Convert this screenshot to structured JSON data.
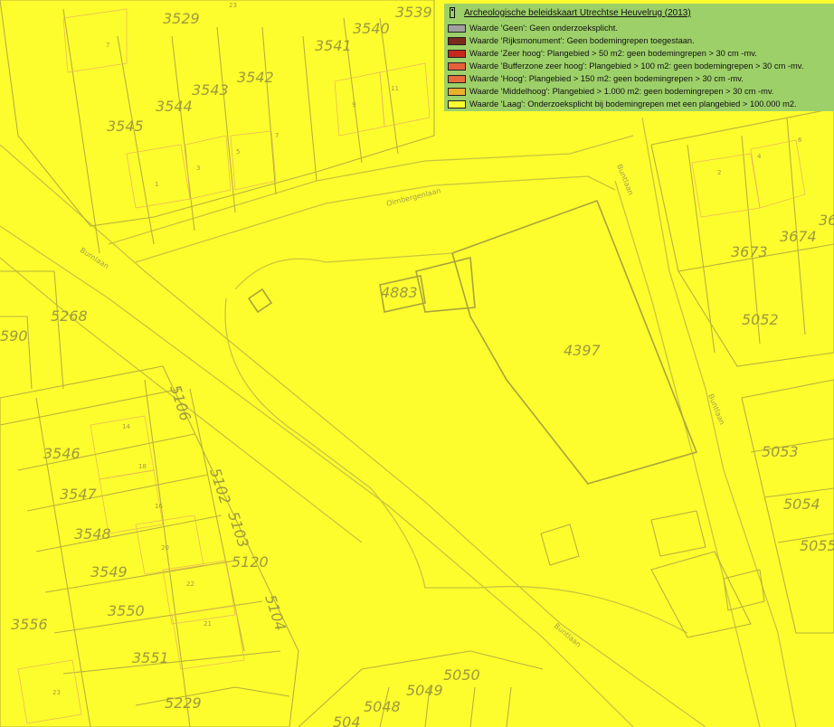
{
  "legend": {
    "title": "Archeologische beleidskaart Utrechtse Heuvelrug (2013)",
    "items": [
      {
        "label": "Waarde 'Geen': Geen onderzoeksplicht.",
        "color": "#a0a0a0"
      },
      {
        "label": "Waarde 'Rijksmonument': Geen bodemingrepen toegestaan.",
        "color": "#7b2a1c"
      },
      {
        "label": "Waarde 'Zeer hoog': Plangebied > 50 m2: geen bodemingrepen > 30 cm -mv.",
        "color": "#c8281c"
      },
      {
        "label": "Waarde 'Bufferzone zeer hoog': Plangebied > 100 m2: geen bodemingrepen > 30 cm -mv.",
        "color": "#e5603a"
      },
      {
        "label": "Waarde 'Hoog': Plangebied > 150 m2: geen bodemingrepen > 30 cm -mv.",
        "color": "#e86b3c"
      },
      {
        "label": "Waarde 'Middelhoog': Plangebied > 1.000 m2: geen bodemingrepen > 30 cm -mv.",
        "color": "#eab02a"
      },
      {
        "label": "Waarde 'Laag': Onderzoeksplicht bij bodemingrepen met een plangebied > 100.000 m2.",
        "color": "#fdfd2e"
      }
    ]
  },
  "parcels": [
    "3529",
    "3539",
    "3540",
    "3541",
    "3542",
    "3543",
    "3544",
    "3545",
    "3673",
    "3674",
    "36",
    "4883",
    "4397",
    "5268",
    "590",
    "5052",
    "5053",
    "5054",
    "5055",
    "5106",
    "3546",
    "3547",
    "3548",
    "3549",
    "3550",
    "3551",
    "3556",
    "5102",
    "5103",
    "5120",
    "5104",
    "5229",
    "5050",
    "5049",
    "5048",
    "504"
  ],
  "house_numbers": [
    "23",
    "7",
    "11",
    "9",
    "7",
    "5",
    "3",
    "1",
    "6",
    "4",
    "2",
    "14",
    "18",
    "16",
    "20",
    "22",
    "21",
    "23"
  ],
  "streets": [
    "Olmbergenlaan",
    "Burnlaan",
    "Buntlaan",
    "Buntlaan",
    "Buntlaan"
  ],
  "map_colors": {
    "background": "#fdfd2e",
    "lines": "#b8b23a",
    "legend_bg": "#9dd068"
  }
}
